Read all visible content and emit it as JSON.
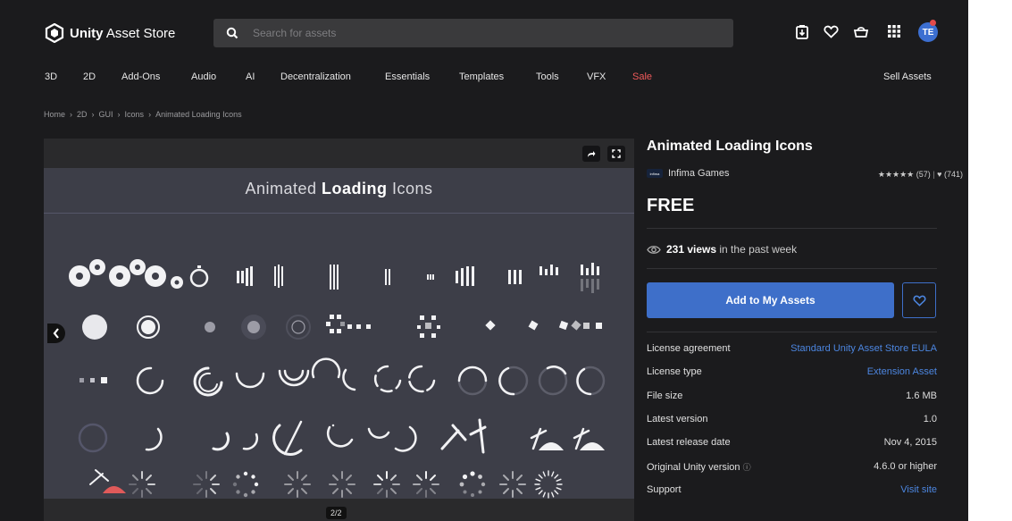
{
  "header": {
    "logo_bold": "Unity",
    "logo_rest": " Asset Store",
    "search_placeholder": "Search for assets",
    "avatar_initials": "TE"
  },
  "nav": {
    "items": [
      "3D",
      "2D",
      "Add-Ons",
      "Audio",
      "AI",
      "Decentralization",
      "Essentials",
      "Templates",
      "Tools",
      "VFX",
      "Sale"
    ],
    "sell": "Sell Assets"
  },
  "breadcrumb": [
    "Home",
    "2D",
    "GUI",
    "Icons",
    "Animated Loading Icons"
  ],
  "viewer": {
    "preview_title_pre": "Animated ",
    "preview_title_bold": "Loading",
    "preview_title_post": " Icons",
    "pager": "2/2"
  },
  "product": {
    "title": "Animated Loading Icons",
    "publisher": "Infima Games",
    "publisher_logo_text": "infima",
    "stars": "★★★★★",
    "rating_count": "(57)",
    "favorites": "(741)",
    "price": "FREE",
    "views_count": "231 views",
    "views_suffix": " in the past week",
    "add_button": "Add to My Assets"
  },
  "details": [
    {
      "label": "License agreement",
      "value": "Standard Unity Asset Store EULA",
      "link": true
    },
    {
      "label": "License type",
      "value": "Extension Asset",
      "link": true
    },
    {
      "label": "File size",
      "value": "1.6 MB",
      "link": false
    },
    {
      "label": "Latest version",
      "value": "1.0",
      "link": false
    },
    {
      "label": "Latest release date",
      "value": "Nov 4, 2015",
      "link": false
    },
    {
      "label": "Original Unity version",
      "value": "4.6.0 or higher",
      "link": false
    },
    {
      "label": "Support",
      "value": "Visit site",
      "link": true
    }
  ],
  "colors": {
    "page_bg": "#1b1b1d",
    "accent": "#3e6fc9",
    "link": "#4c86e0",
    "sale": "#f05a5a",
    "preview_bg": "#3d3e48",
    "pickaxe_red": "#e05a5a"
  }
}
